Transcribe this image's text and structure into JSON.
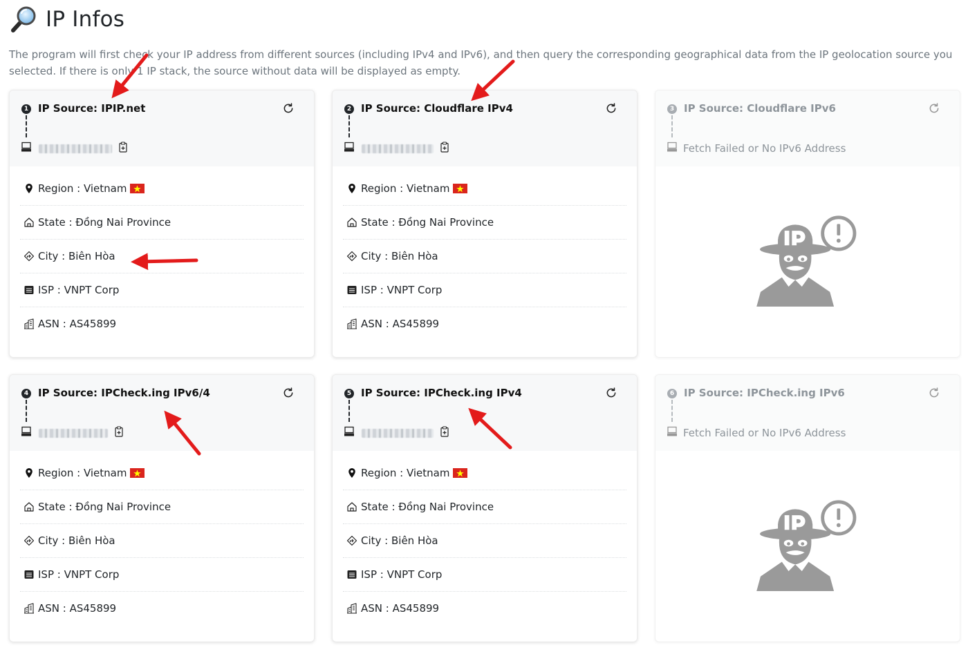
{
  "page": {
    "title": "IP Infos",
    "description": "The program will first check your IP address from different sources (including IPv4 and IPv6), and then query the corresponding geographical data from the IP geolocation source you selected. If there is only 1 IP stack, the source without data will be displayed as empty."
  },
  "icons": {
    "header": "magnifying-glass-icon",
    "refresh": "refresh-icon",
    "ip": "computer-icon",
    "copy": "clipboard-icon",
    "region": "location-pin-icon",
    "state": "building-icon",
    "city": "signpost-icon",
    "isp": "router-icon",
    "asn": "buildings-icon"
  },
  "colors": {
    "accent": "#212529",
    "muted": "#8e959b",
    "flag_red": "#da251d",
    "flag_star": "#ffff00",
    "annotation_arrow": "#e31b1b"
  },
  "cards": [
    {
      "number": "1",
      "source": "IP Source: IPIP.net",
      "status": "ok",
      "region_label": "Region : Vietnam",
      "state_label": "State : Đồng Nai Province",
      "city_label": "City : Biên Hòa",
      "isp_label": "ISP : VNPT Corp",
      "asn_label": "ASN : AS45899"
    },
    {
      "number": "2",
      "source": "IP Source: Cloudflare IPv4",
      "status": "ok",
      "region_label": "Region : Vietnam",
      "state_label": "State : Đồng Nai Province",
      "city_label": "City : Biên Hòa",
      "isp_label": "ISP : VNPT Corp",
      "asn_label": "ASN : AS45899"
    },
    {
      "number": "3",
      "source": "IP Source: Cloudflare IPv6",
      "status": "failed",
      "fail_text": "Fetch Failed or No IPv6 Address"
    },
    {
      "number": "4",
      "source": "IP Source: IPCheck.ing IPv6/4",
      "status": "ok",
      "region_label": "Region : Vietnam",
      "state_label": "State : Đồng Nai Province",
      "city_label": "City : Biên Hòa",
      "isp_label": "ISP : VNPT Corp",
      "asn_label": "ASN : AS45899"
    },
    {
      "number": "5",
      "source": "IP Source: IPCheck.ing IPv4",
      "status": "ok",
      "region_label": "Region : Vietnam",
      "state_label": "State : Đồng Nai Province",
      "city_label": "City : Biên Hòa",
      "isp_label": "ISP : VNPT Corp",
      "asn_label": "ASN : AS45899"
    },
    {
      "number": "6",
      "source": "IP Source: IPCheck.ing IPv6",
      "status": "failed",
      "fail_text": "Fetch Failed or No IPv6 Address"
    }
  ]
}
